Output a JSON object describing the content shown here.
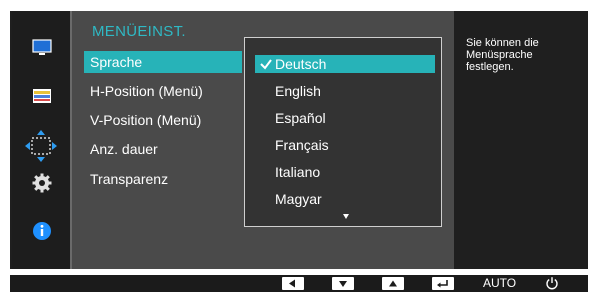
{
  "menu": {
    "title": "MENÜEINST.",
    "items": [
      {
        "label": "Sprache",
        "active": true
      },
      {
        "label": "H-Position (Menü)"
      },
      {
        "label": "V-Position (Menü)"
      },
      {
        "label": "Anz. dauer"
      },
      {
        "label": "Transparenz"
      }
    ]
  },
  "dropdown": {
    "options": [
      "Deutsch",
      "English",
      "Español",
      "Français",
      "Italiano",
      "Magyar"
    ],
    "selected": "Deutsch"
  },
  "help": {
    "text": "Sie können die Menüsprache festlegen."
  },
  "sidebar_icons": [
    "monitor-icon",
    "color-bars-icon",
    "position-arrows-icon",
    "gear-icon",
    "info-icon"
  ],
  "buttons": {
    "auto_label": "AUTO",
    "icons": [
      "left-arrow-icon",
      "down-arrow-icon",
      "up-arrow-icon",
      "enter-icon",
      "power-icon"
    ]
  },
  "colors": {
    "accent": "#27b3b8",
    "title": "#2fb9c4",
    "info_blue": "#1e90ff"
  }
}
